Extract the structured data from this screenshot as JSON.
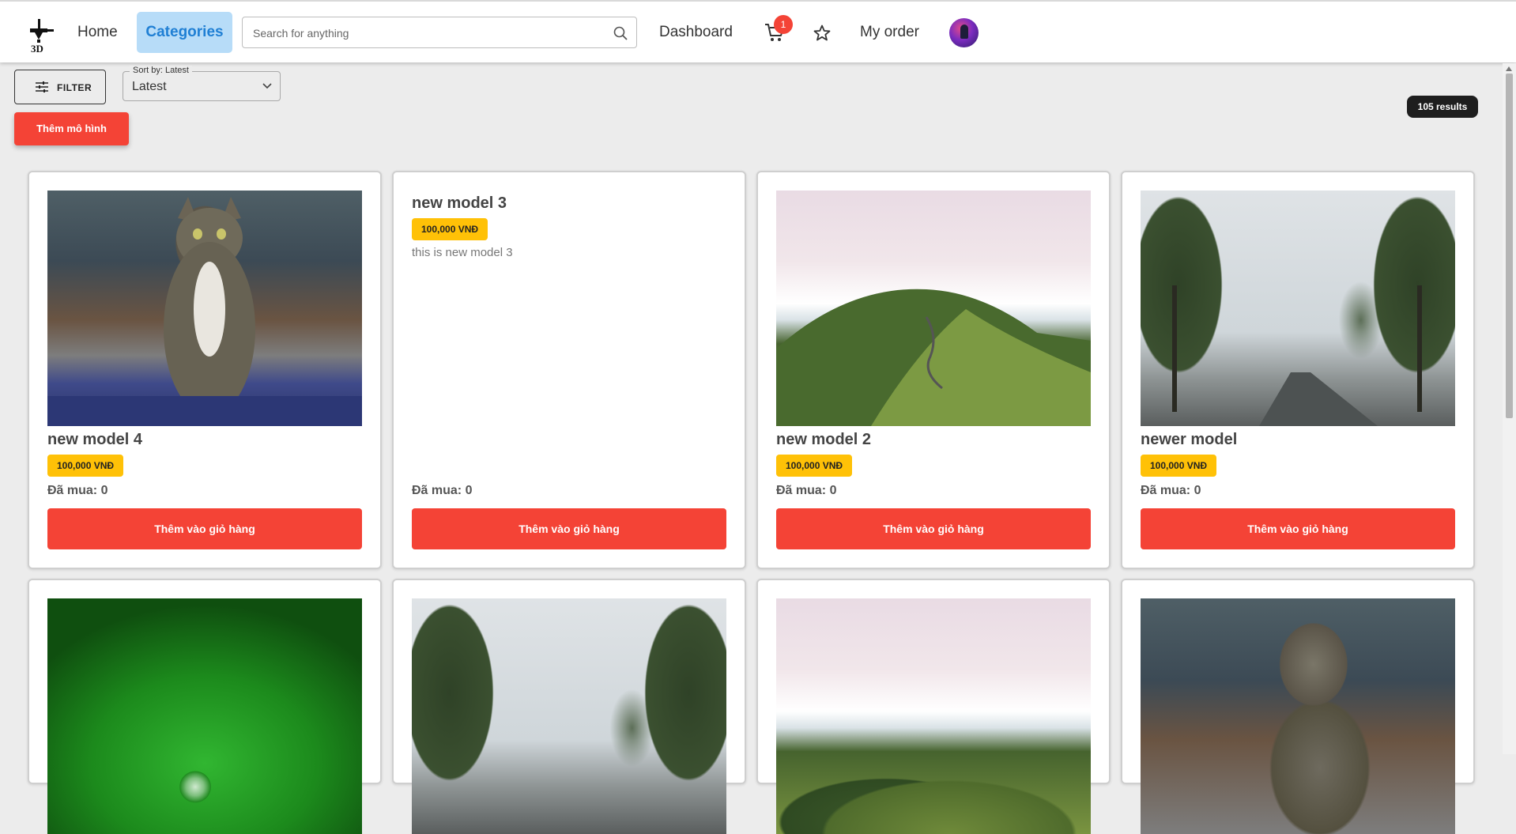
{
  "nav": {
    "home": "Home",
    "categories": "Categories",
    "search_placeholder": "Search for anything",
    "dashboard": "Dashboard",
    "cart_count": "1",
    "my_order": "My order",
    "logo_text": "3D"
  },
  "toolbar": {
    "filter_label": "FILTER",
    "sort_label": "Sort by: Latest",
    "sort_value": "Latest",
    "add_model_label": "Thêm mô hình",
    "results_label": "105 results"
  },
  "products": [
    {
      "title": "new model 4",
      "price": "100,000 VNĐ",
      "sold": "Đã mua: 0",
      "button": "Thêm vào giỏ hàng",
      "image": "tabby-cat"
    },
    {
      "title": "new model 3",
      "price": "100,000 VNĐ",
      "description": "this is new model 3",
      "sold": "Đã mua: 0",
      "button": "Thêm vào giỏ hàng"
    },
    {
      "title": "new model 2",
      "price": "100,000 VNĐ",
      "sold": "Đã mua: 0",
      "button": "Thêm vào giỏ hàng",
      "image": "foggy-hills"
    },
    {
      "title": "newer model",
      "price": "100,000 VNĐ",
      "sold": "Đã mua: 0",
      "button": "Thêm vào giỏ hàng",
      "image": "tree-lined-road"
    }
  ],
  "products_row2": [
    {
      "image": "green-leaf-droplet"
    },
    {
      "image": "tree-lined-road"
    },
    {
      "image": "foggy-hills"
    },
    {
      "image": "tabby-cat"
    }
  ],
  "colors": {
    "accent": "#f44336",
    "price_badge": "#ffc107",
    "nav_active_bg": "#b7dcf8",
    "nav_active_text": "#1f7fd4"
  }
}
